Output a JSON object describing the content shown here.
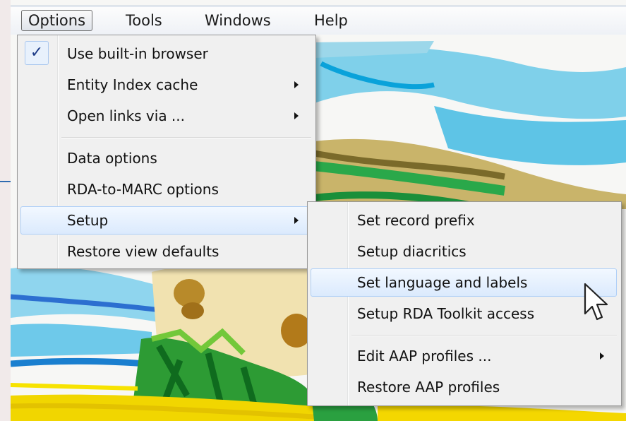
{
  "menubar": {
    "items": [
      {
        "label": "Options",
        "active": true
      },
      {
        "label": "Tools"
      },
      {
        "label": "Windows"
      },
      {
        "label": "Help"
      }
    ]
  },
  "options_menu": {
    "items": [
      {
        "label": "Use built-in browser",
        "checked": true,
        "check_glyph": "✓"
      },
      {
        "label": "Entity Index cache",
        "submenu": true
      },
      {
        "label": "Open links via ...",
        "submenu": true
      },
      {
        "label": "Data options"
      },
      {
        "label": "RDA-to-MARC options"
      },
      {
        "label": "Setup",
        "submenu": true,
        "highlighted": true
      },
      {
        "label": "Restore view defaults"
      }
    ]
  },
  "setup_submenu": {
    "items": [
      {
        "label": "Set record prefix"
      },
      {
        "label": "Setup diacritics"
      },
      {
        "label": "Set language and labels",
        "highlighted": true
      },
      {
        "label": "Setup RDA Toolkit access"
      },
      {
        "label": "Edit AAP profiles ...",
        "submenu": true
      },
      {
        "label": "Restore AAP profiles"
      }
    ]
  },
  "colors": {
    "highlight": "#dbeafd",
    "menu_bg": "#f0f0f0",
    "check": "#1d3b87"
  }
}
